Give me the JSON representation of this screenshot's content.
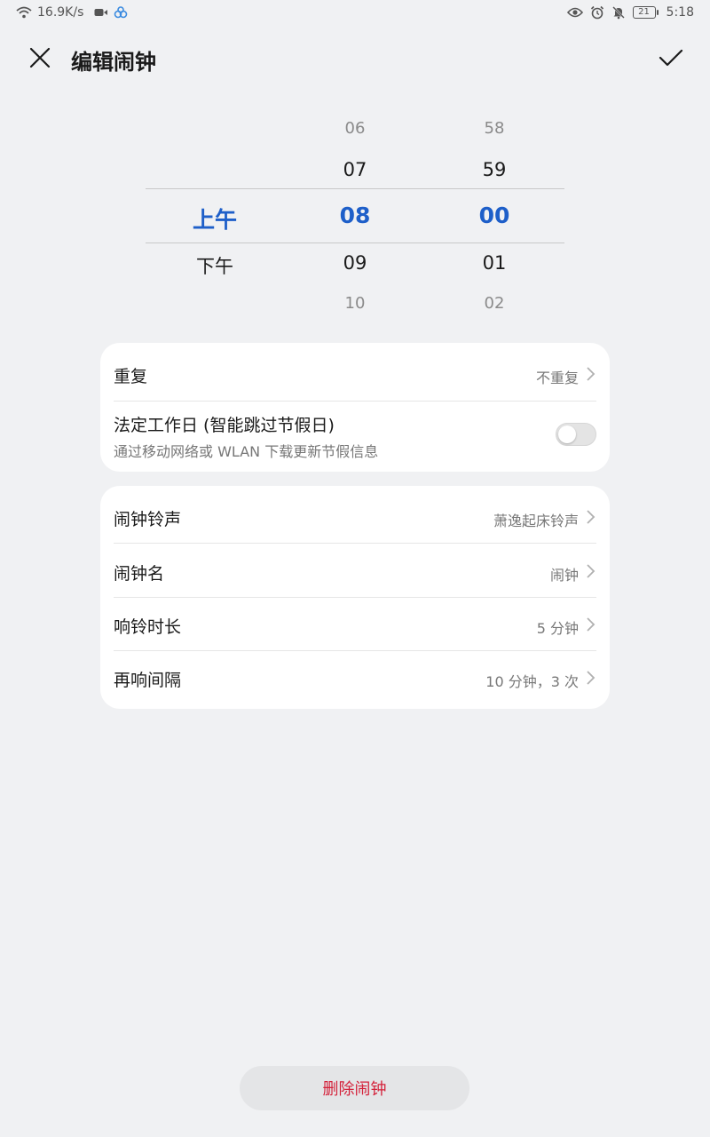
{
  "status_bar": {
    "speed": "16.9K/s",
    "battery": "21",
    "time": "5:18",
    "left_icons": [
      "wifi-icon",
      "video-icon",
      "link-icon"
    ],
    "right_icons": [
      "eye-icon",
      "alarm-icon",
      "bell-off-icon",
      "battery-icon"
    ]
  },
  "header": {
    "title": "编辑闹钟",
    "close_icon": "close-icon",
    "confirm_icon": "check-icon"
  },
  "picker": {
    "period": {
      "options": [
        "上午",
        "下午"
      ],
      "selected": "上午"
    },
    "hour": {
      "above_far": "06",
      "above": "07",
      "selected": "08",
      "below": "09",
      "below_far": "10"
    },
    "minute": {
      "above_far": "58",
      "above": "59",
      "selected": "00",
      "below": "01",
      "below_far": "02"
    },
    "accent_color": "#1e5fc9"
  },
  "repeat_card": {
    "repeat_label": "重复",
    "repeat_value": "不重复",
    "workday_label": "法定工作日 (智能跳过节假日)",
    "workday_sub": "通过移动网络或 WLAN 下载更新节假信息",
    "workday_enabled": false
  },
  "settings_card": {
    "rows": [
      {
        "label": "闹钟铃声",
        "value": "萧逸起床铃声"
      },
      {
        "label": "闹钟名",
        "value": "闹钟"
      },
      {
        "label": "响铃时长",
        "value": "5 分钟"
      },
      {
        "label": "再响间隔",
        "value": "10 分钟，3 次"
      }
    ]
  },
  "delete_button": {
    "label": "删除闹钟",
    "color": "#d4213a"
  }
}
